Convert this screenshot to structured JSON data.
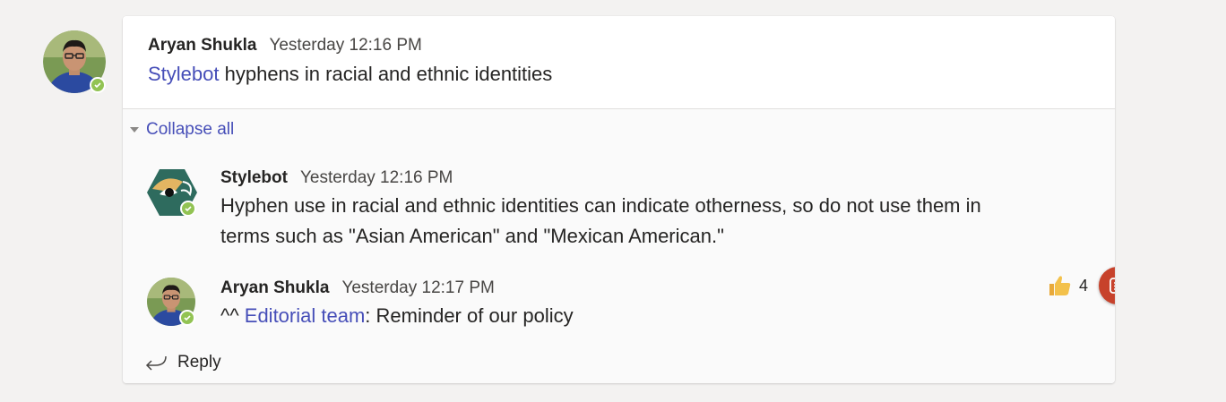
{
  "thread": {
    "author": "Aryan Shukla",
    "time": "Yesterday 12:16 PM",
    "mention": "Stylebot",
    "message": " hyphens in racial and ethnic identities"
  },
  "collapse_label": "Collapse all",
  "replies": [
    {
      "author": "Stylebot",
      "time": "Yesterday 12:16 PM",
      "line1": "Hyphen use in racial and ethnic identities can indicate otherness, so do not use them in",
      "line2": "terms such as \"Asian American\" and \"Mexican American.\""
    },
    {
      "author": "Aryan Shukla",
      "time": "Yesterday 12:17 PM",
      "prefix": "^^ ",
      "mention": "Editorial team",
      "message": ": Reminder of our policy",
      "reaction_count": "4",
      "reaction_icon": "thumbs-up-icon"
    }
  ],
  "reply_label": "Reply",
  "colors": {
    "accent": "#464eb8",
    "presence": "#92c353",
    "action": "#c7422b"
  }
}
